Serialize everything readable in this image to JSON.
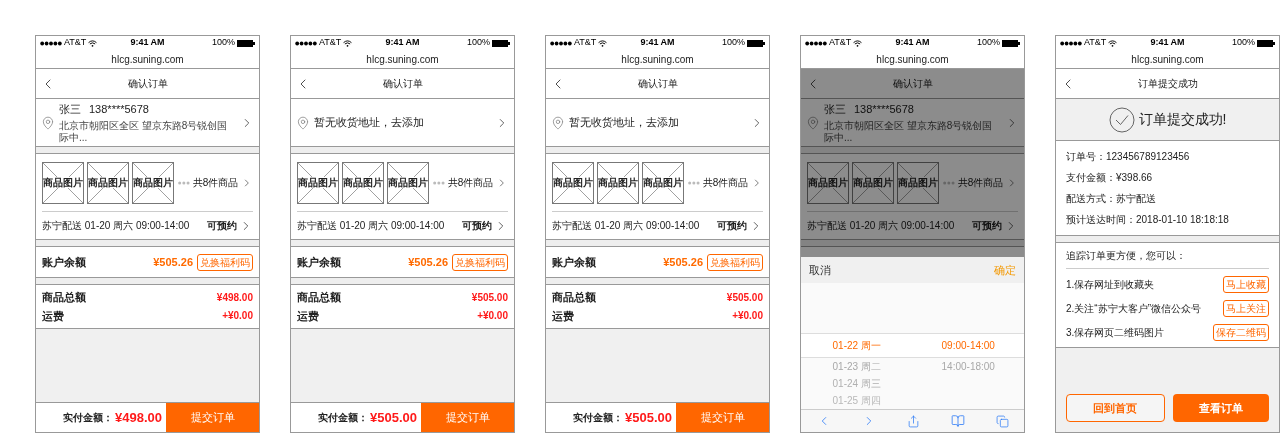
{
  "phones": [
    {
      "kind": "confirm",
      "status_bar": {
        "carrier": "AT&T",
        "time": "9:41 AM",
        "battery": "100%"
      },
      "url": "hlcg.suning.com",
      "title": "确认订单",
      "address": {
        "kind": "filled",
        "name": "张三",
        "phone": "138****5678",
        "detail": "北京市朝阳区全区 望京东路8号锐创国际中..."
      },
      "products": {
        "thumbnails": [
          "商品图片",
          "商品图片",
          "商品图片"
        ],
        "count": "共8件商品"
      },
      "delivery": {
        "text": "苏宁配送 01-20 周六 09:00-14:00",
        "action": "可预约"
      },
      "balance": {
        "label": "账户余额",
        "amount": "¥505.26",
        "button": "兑换福利码"
      },
      "totals": [
        {
          "label": "商品总额",
          "value": "¥498.00"
        },
        {
          "label": "运费",
          "value": "+¥0.00"
        }
      ],
      "footer": {
        "label": "实付金额：",
        "amount": "¥498.00",
        "button": "提交订单"
      }
    },
    {
      "kind": "confirm",
      "status_bar": {
        "carrier": "AT&T",
        "time": "9:41 AM",
        "battery": "100%"
      },
      "url": "hlcg.suning.com",
      "title": "确认订单",
      "address": {
        "kind": "empty",
        "text": "暂无收货地址，去添加"
      },
      "products": {
        "thumbnails": [
          "商品图片",
          "商品图片",
          "商品图片"
        ],
        "count": "共8件商品"
      },
      "delivery": {
        "text": "苏宁配送 01-20 周六 09:00-14:00",
        "action": "可预约"
      },
      "balance": {
        "label": "账户余额",
        "amount": "¥505.26",
        "button": "兑换福利码"
      },
      "totals": [
        {
          "label": "商品总额",
          "value": "¥505.00"
        },
        {
          "label": "运费",
          "value": "+¥0.00"
        }
      ],
      "footer": {
        "label": "实付金额：",
        "amount": "¥505.00",
        "button": "提交订单"
      }
    },
    {
      "kind": "confirm",
      "status_bar": {
        "carrier": "AT&T",
        "time": "9:41 AM",
        "battery": "100%"
      },
      "url": "hlcg.suning.com",
      "title": "确认订单",
      "address": {
        "kind": "empty",
        "text": "暂无收货地址，去添加"
      },
      "products": {
        "thumbnails": [
          "商品图片",
          "商品图片",
          "商品图片"
        ],
        "count": "共8件商品"
      },
      "delivery": {
        "text": "苏宁配送 01-20 周六 09:00-14:00",
        "action": "可预约"
      },
      "balance": {
        "label": "账户余额",
        "amount": "¥505.26",
        "button": "兑换福利码"
      },
      "totals": [
        {
          "label": "商品总额",
          "value": "¥505.00"
        },
        {
          "label": "运费",
          "value": "+¥0.00"
        }
      ],
      "footer": {
        "label": "实付金额：",
        "amount": "¥505.00",
        "button": "提交订单"
      }
    },
    {
      "kind": "picker",
      "status_bar": {
        "carrier": "AT&T",
        "time": "9:41 AM",
        "battery": "100%"
      },
      "url": "hlcg.suning.com",
      "title": "确认订单",
      "address": {
        "kind": "filled",
        "name": "张三",
        "phone": "138****5678",
        "detail": "北京市朝阳区全区 望京东路8号锐创国际中..."
      },
      "products": {
        "thumbnails": [
          "商品图片",
          "商品图片",
          "商品图片"
        ],
        "count": "共8件商品"
      },
      "delivery": {
        "text": "苏宁配送 01-20 周六 09:00-14:00",
        "action": "可预约"
      },
      "picker": {
        "cancel": "取消",
        "confirm": "确定",
        "columns": [
          {
            "options": [
              {
                "label": "01-22 周一",
                "selected": true
              },
              {
                "label": "01-23 周二",
                "selected": false
              },
              {
                "label": "01-24 周三",
                "selected": false
              },
              {
                "label": "01-25 周四",
                "selected": false
              }
            ]
          },
          {
            "options": [
              {
                "label": "09:00-14:00",
                "selected": true
              },
              {
                "label": "14:00-18:00",
                "selected": false
              }
            ]
          }
        ]
      }
    },
    {
      "kind": "success",
      "status_bar": {
        "carrier": "AT&T",
        "time": "9:41 AM",
        "battery": "100%"
      },
      "url": "hlcg.suning.com",
      "title": "订单提交成功",
      "banner": "订单提交成功!",
      "info": [
        "订单号：123456789123456",
        "支付金额：¥398.66",
        "配送方式：苏宁配送",
        "预计送达时间：2018-01-10 18:18:18"
      ],
      "tracking": {
        "heading": "追踪订单更方便，您可以：",
        "items": [
          {
            "text": "1.保存网址到收藏夹",
            "button": "马上收藏"
          },
          {
            "text": "2.关注“苏宁大客户”微信公众号",
            "button": "马上关注"
          },
          {
            "text": "3.保存网页二维码图片",
            "button": "保存二维码"
          }
        ]
      },
      "buttons": [
        {
          "label": "回到首页",
          "kind": "outline"
        },
        {
          "label": "查看订单",
          "kind": "filled"
        }
      ]
    }
  ]
}
